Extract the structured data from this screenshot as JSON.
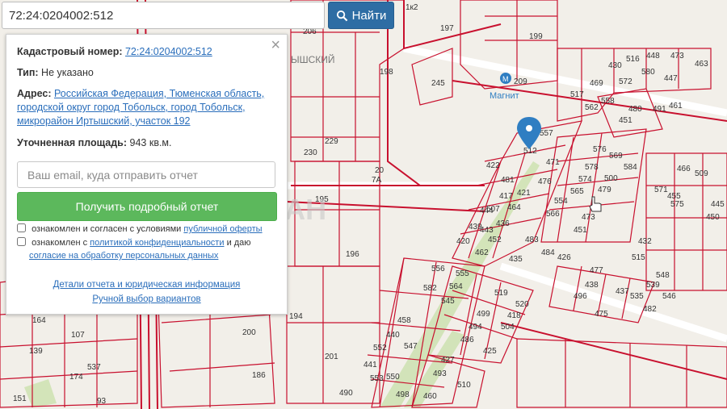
{
  "search": {
    "value": "72:24:0204002:512",
    "button_label": "Найти"
  },
  "panel": {
    "cadastral_label": "Кадастровый номер:",
    "cadastral_value": "72:24:0204002:512",
    "type_label": "Тип:",
    "type_value": "Не указано",
    "address_label": "Адрес:",
    "address_value": "Российская Федерация, Тюменская область, городской округ город Тобольск, город Тобольск, микрорайон Иртышский, участок 192",
    "area_label": "Уточненная площадь:",
    "area_value": "943 кв.м.",
    "email_placeholder": "Ваш email, куда отправить отчет",
    "report_button": "Получить подробный отчет",
    "consent1_text": "ознакомлен и согласен с условиями",
    "consent1_link": "публичной оферты",
    "consent2_text": "ознакомлен с",
    "consent2_link": "политикой конфиденциальности",
    "consent2_and": "и даю",
    "consent3_link": "согласие на обработку персональных данных",
    "details_link": "Детали отчета и юридическая информация",
    "manual_link": "Ручной выбор вариантов"
  },
  "map": {
    "store_label": "Магнит",
    "area_label": "ЫШСКИЙ",
    "watermark": "ЦИАН",
    "numbers": [
      "206",
      "1к2",
      "197",
      "199",
      "209",
      "198",
      "245",
      "230",
      "229",
      "20",
      "7А",
      "195",
      "196",
      "200",
      "194",
      "201",
      "186",
      "151",
      "174",
      "164",
      "107",
      "139",
      "537",
      "93",
      "512",
      "557",
      "471",
      "422",
      "476",
      "481",
      "417",
      "421",
      "507",
      "464",
      "444",
      "443",
      "436",
      "439",
      "452",
      "420",
      "462",
      "435",
      "483",
      "484",
      "426",
      "576",
      "578",
      "569",
      "574",
      "500",
      "584",
      "565",
      "479",
      "554",
      "473",
      "566",
      "451",
      "455",
      "517",
      "469",
      "430",
      "516",
      "448",
      "473",
      "463",
      "562",
      "558",
      "572",
      "580",
      "447",
      "451",
      "480",
      "491",
      "461",
      "466",
      "509",
      "571",
      "445",
      "575",
      "450",
      "432",
      "515",
      "548",
      "556",
      "555",
      "564",
      "519",
      "520",
      "582",
      "499",
      "418",
      "458",
      "545",
      "494",
      "504",
      "440",
      "547",
      "486",
      "425",
      "552",
      "427",
      "441",
      "550",
      "493",
      "510",
      "553",
      "498",
      "460",
      "490",
      "477",
      "496",
      "482",
      "438",
      "475",
      "437",
      "535",
      "539",
      "546"
    ]
  },
  "colors": {
    "accent": "#2e6da4",
    "report": "#5cb85c",
    "parcel": "#d01818",
    "link": "#2a6ebb",
    "pin": "#2f7ec2"
  }
}
